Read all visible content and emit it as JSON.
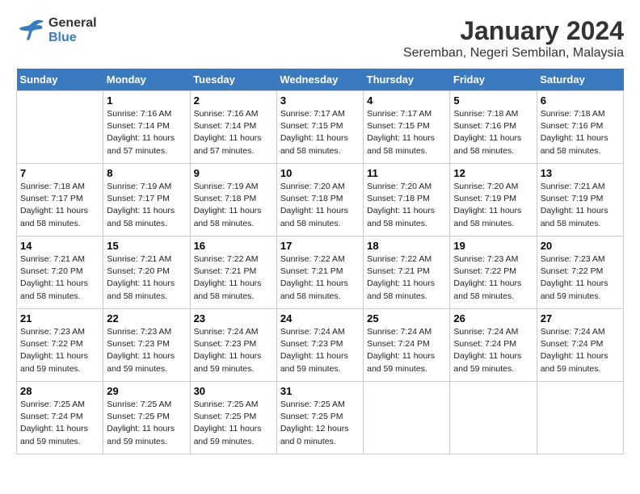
{
  "header": {
    "logo_line1": "General",
    "logo_line2": "Blue",
    "title": "January 2024",
    "subtitle": "Seremban, Negeri Sembilan, Malaysia"
  },
  "days_of_week": [
    "Sunday",
    "Monday",
    "Tuesday",
    "Wednesday",
    "Thursday",
    "Friday",
    "Saturday"
  ],
  "weeks": [
    [
      {
        "day": "",
        "info": ""
      },
      {
        "day": "1",
        "info": "Sunrise: 7:16 AM\nSunset: 7:14 PM\nDaylight: 11 hours\nand 57 minutes."
      },
      {
        "day": "2",
        "info": "Sunrise: 7:16 AM\nSunset: 7:14 PM\nDaylight: 11 hours\nand 57 minutes."
      },
      {
        "day": "3",
        "info": "Sunrise: 7:17 AM\nSunset: 7:15 PM\nDaylight: 11 hours\nand 58 minutes."
      },
      {
        "day": "4",
        "info": "Sunrise: 7:17 AM\nSunset: 7:15 PM\nDaylight: 11 hours\nand 58 minutes."
      },
      {
        "day": "5",
        "info": "Sunrise: 7:18 AM\nSunset: 7:16 PM\nDaylight: 11 hours\nand 58 minutes."
      },
      {
        "day": "6",
        "info": "Sunrise: 7:18 AM\nSunset: 7:16 PM\nDaylight: 11 hours\nand 58 minutes."
      }
    ],
    [
      {
        "day": "7",
        "info": "Sunrise: 7:18 AM\nSunset: 7:17 PM\nDaylight: 11 hours\nand 58 minutes."
      },
      {
        "day": "8",
        "info": "Sunrise: 7:19 AM\nSunset: 7:17 PM\nDaylight: 11 hours\nand 58 minutes."
      },
      {
        "day": "9",
        "info": "Sunrise: 7:19 AM\nSunset: 7:18 PM\nDaylight: 11 hours\nand 58 minutes."
      },
      {
        "day": "10",
        "info": "Sunrise: 7:20 AM\nSunset: 7:18 PM\nDaylight: 11 hours\nand 58 minutes."
      },
      {
        "day": "11",
        "info": "Sunrise: 7:20 AM\nSunset: 7:18 PM\nDaylight: 11 hours\nand 58 minutes."
      },
      {
        "day": "12",
        "info": "Sunrise: 7:20 AM\nSunset: 7:19 PM\nDaylight: 11 hours\nand 58 minutes."
      },
      {
        "day": "13",
        "info": "Sunrise: 7:21 AM\nSunset: 7:19 PM\nDaylight: 11 hours\nand 58 minutes."
      }
    ],
    [
      {
        "day": "14",
        "info": "Sunrise: 7:21 AM\nSunset: 7:20 PM\nDaylight: 11 hours\nand 58 minutes."
      },
      {
        "day": "15",
        "info": "Sunrise: 7:21 AM\nSunset: 7:20 PM\nDaylight: 11 hours\nand 58 minutes."
      },
      {
        "day": "16",
        "info": "Sunrise: 7:22 AM\nSunset: 7:21 PM\nDaylight: 11 hours\nand 58 minutes."
      },
      {
        "day": "17",
        "info": "Sunrise: 7:22 AM\nSunset: 7:21 PM\nDaylight: 11 hours\nand 58 minutes."
      },
      {
        "day": "18",
        "info": "Sunrise: 7:22 AM\nSunset: 7:21 PM\nDaylight: 11 hours\nand 58 minutes."
      },
      {
        "day": "19",
        "info": "Sunrise: 7:23 AM\nSunset: 7:22 PM\nDaylight: 11 hours\nand 58 minutes."
      },
      {
        "day": "20",
        "info": "Sunrise: 7:23 AM\nSunset: 7:22 PM\nDaylight: 11 hours\nand 59 minutes."
      }
    ],
    [
      {
        "day": "21",
        "info": "Sunrise: 7:23 AM\nSunset: 7:22 PM\nDaylight: 11 hours\nand 59 minutes."
      },
      {
        "day": "22",
        "info": "Sunrise: 7:23 AM\nSunset: 7:23 PM\nDaylight: 11 hours\nand 59 minutes."
      },
      {
        "day": "23",
        "info": "Sunrise: 7:24 AM\nSunset: 7:23 PM\nDaylight: 11 hours\nand 59 minutes."
      },
      {
        "day": "24",
        "info": "Sunrise: 7:24 AM\nSunset: 7:23 PM\nDaylight: 11 hours\nand 59 minutes."
      },
      {
        "day": "25",
        "info": "Sunrise: 7:24 AM\nSunset: 7:24 PM\nDaylight: 11 hours\nand 59 minutes."
      },
      {
        "day": "26",
        "info": "Sunrise: 7:24 AM\nSunset: 7:24 PM\nDaylight: 11 hours\nand 59 minutes."
      },
      {
        "day": "27",
        "info": "Sunrise: 7:24 AM\nSunset: 7:24 PM\nDaylight: 11 hours\nand 59 minutes."
      }
    ],
    [
      {
        "day": "28",
        "info": "Sunrise: 7:25 AM\nSunset: 7:24 PM\nDaylight: 11 hours\nand 59 minutes."
      },
      {
        "day": "29",
        "info": "Sunrise: 7:25 AM\nSunset: 7:25 PM\nDaylight: 11 hours\nand 59 minutes."
      },
      {
        "day": "30",
        "info": "Sunrise: 7:25 AM\nSunset: 7:25 PM\nDaylight: 11 hours\nand 59 minutes."
      },
      {
        "day": "31",
        "info": "Sunrise: 7:25 AM\nSunset: 7:25 PM\nDaylight: 12 hours\nand 0 minutes."
      },
      {
        "day": "",
        "info": ""
      },
      {
        "day": "",
        "info": ""
      },
      {
        "day": "",
        "info": ""
      }
    ]
  ]
}
